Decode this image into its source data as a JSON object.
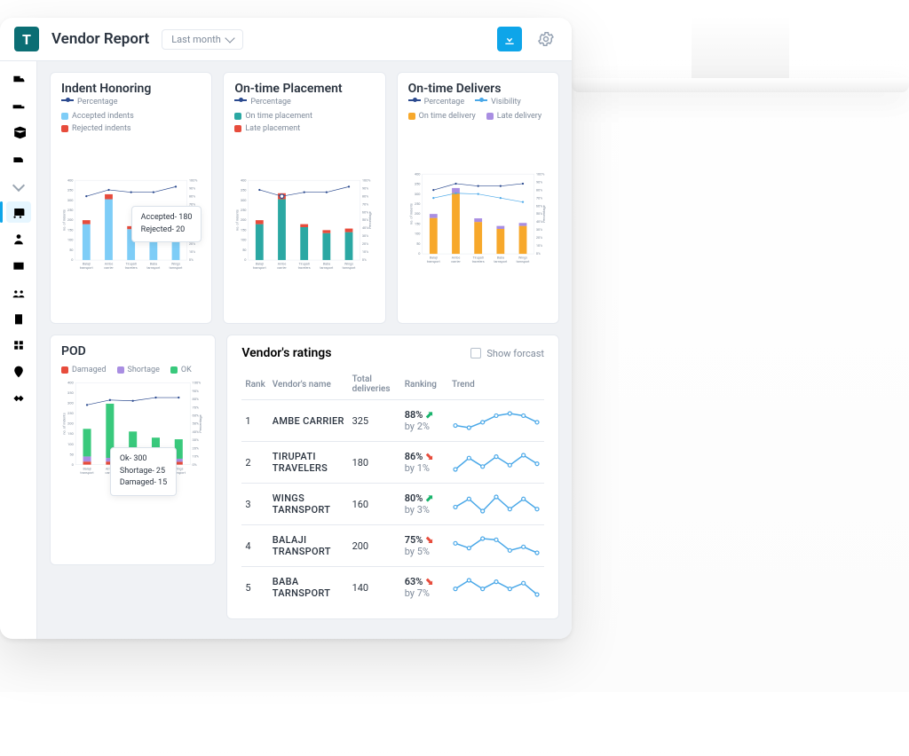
{
  "header": {
    "logo_letter": "T",
    "title": "Vendor Report",
    "period_label": "Last month"
  },
  "sidebar": {
    "items": [
      "truck",
      "trailer",
      "box",
      "van",
      "chevron",
      "bus",
      "user",
      "card",
      "team",
      "building",
      "apps",
      "map-pin",
      "handshake"
    ],
    "active_index": 5
  },
  "categories": [
    "Balaji transport",
    "Ambe carrier",
    "Tirupati travelers",
    "Baba tarnsport",
    "Wings tarnsport"
  ],
  "chart_data": [
    {
      "id": "indent",
      "title": "Indent Honoring",
      "type": "bar+line",
      "xlabel": "",
      "ylabel": "no. of indents",
      "y2label": "Percentage",
      "ylim": [
        0,
        400
      ],
      "y2lim": [
        0,
        100
      ],
      "yticks": [
        0,
        50,
        100,
        150,
        200,
        250,
        300,
        350,
        400
      ],
      "y2ticks": [
        0,
        10,
        20,
        30,
        40,
        50,
        60,
        70,
        80,
        90,
        100
      ],
      "legend_lines": [
        {
          "name": "Percentage",
          "color": "#2b4a8f"
        }
      ],
      "series": [
        {
          "name": "Accepted indents",
          "color": "#7ecdf7",
          "values": [
            180,
            305,
            155,
            130,
            140
          ]
        },
        {
          "name": "Rejected indents",
          "color": "#e74c3c",
          "values": [
            20,
            25,
            15,
            15,
            18
          ]
        }
      ],
      "line": {
        "name": "Percentage",
        "color": "#2b4a8f",
        "values": [
          80,
          88,
          85,
          85,
          92
        ]
      },
      "tooltip": {
        "index": 2,
        "lines": [
          "Accepted- 180",
          "Rejected- 20"
        ]
      }
    },
    {
      "id": "placement",
      "title": "On-time Placement",
      "type": "bar+line",
      "ylabel": "no. of indents",
      "y2label": "Percentage",
      "ylim": [
        0,
        400
      ],
      "y2lim": [
        0,
        100
      ],
      "yticks": [
        0,
        50,
        100,
        150,
        200,
        250,
        300,
        350,
        400
      ],
      "y2ticks": [
        0,
        10,
        20,
        30,
        40,
        50,
        60,
        70,
        80,
        90,
        100
      ],
      "legend_lines": [
        {
          "name": "Percentage",
          "color": "#2b4a8f"
        }
      ],
      "series": [
        {
          "name": "On time placement",
          "color": "#2ba8a3",
          "values": [
            180,
            305,
            165,
            135,
            140
          ]
        },
        {
          "name": "Late placement",
          "color": "#e74c3c",
          "values": [
            20,
            30,
            15,
            15,
            18
          ]
        }
      ],
      "line": {
        "name": "Percentage",
        "color": "#2b4a8f",
        "values": [
          88,
          80,
          85,
          85,
          92
        ]
      },
      "highlight_dot": 1
    },
    {
      "id": "delivers",
      "title": "On-time Delivers",
      "type": "bar+2line",
      "ylabel": "no. of indents",
      "y2label": "Percentage",
      "ylim": [
        0,
        400
      ],
      "y2lim": [
        0,
        100
      ],
      "yticks": [
        0,
        50,
        100,
        150,
        200,
        250,
        300,
        350,
        400
      ],
      "y2ticks": [
        0,
        10,
        20,
        30,
        40,
        50,
        60,
        70,
        80,
        90,
        100
      ],
      "legend_lines": [
        {
          "name": "Percentage",
          "color": "#2b4a8f"
        },
        {
          "name": "Visibility",
          "color": "#4aa8e8"
        }
      ],
      "series": [
        {
          "name": "On time delivery",
          "color": "#f7a82b",
          "values": [
            180,
            305,
            160,
            125,
            140
          ]
        },
        {
          "name": "Late delivery",
          "color": "#a98ee2",
          "values": [
            20,
            25,
            18,
            15,
            15
          ]
        }
      ],
      "line": {
        "name": "Percentage",
        "color": "#2b4a8f",
        "values": [
          80,
          88,
          85,
          85,
          88
        ]
      },
      "line2": {
        "name": "Visibility",
        "color": "#4aa8e8",
        "values": [
          70,
          76,
          75,
          70,
          65
        ]
      }
    },
    {
      "id": "pod",
      "title": "POD",
      "type": "bar+line",
      "ylabel": "no. of indents",
      "y2label": "Percentage",
      "ylim": [
        0,
        400
      ],
      "y2lim": [
        0,
        100
      ],
      "yticks": [
        0,
        50,
        100,
        150,
        200,
        250,
        300,
        350,
        400
      ],
      "y2ticks": [
        0,
        10,
        20,
        30,
        40,
        50,
        60,
        70,
        80,
        90,
        100
      ],
      "legend_lines": [],
      "series": [
        {
          "name": "Damaged",
          "color": "#e74c3c",
          "values": [
            15,
            15,
            12,
            12,
            14
          ]
        },
        {
          "name": "Shortage",
          "color": "#a98ee2",
          "values": [
            25,
            18,
            20,
            15,
            15
          ]
        },
        {
          "name": "OK",
          "color": "#39c97c",
          "values": [
            135,
            265,
            130,
            105,
            95
          ]
        }
      ],
      "line": {
        "name": "Percentage",
        "color": "#2b4a8f",
        "values": [
          73,
          79,
          78,
          82,
          82
        ]
      },
      "tooltip": {
        "index": 1,
        "lines": [
          "Ok- 300",
          "Shortage- 25",
          "Damaged- 15"
        ]
      }
    }
  ],
  "ratings": {
    "title": "Vendor's ratings",
    "show_forecast_label": "Show forcast",
    "columns": [
      "Rank",
      "Vendor's name",
      "Total deliveries",
      "Ranking",
      "Trend"
    ],
    "rows": [
      {
        "rank": 1,
        "name": "AMBE CARRIER",
        "total": 325,
        "pct": "88%",
        "dir": "up",
        "delta": "2%",
        "spark": [
          5,
          3,
          8,
          14,
          16,
          14,
          8
        ]
      },
      {
        "rank": 2,
        "name": "TIRUPATI TRAVELERS",
        "total": 180,
        "pct": "86%",
        "dir": "down",
        "delta": "1%",
        "spark": [
          4,
          12,
          6,
          13,
          7,
          14,
          8
        ]
      },
      {
        "rank": 3,
        "name": "WINGS TARNSPORT",
        "total": 160,
        "pct": "80%",
        "dir": "up",
        "delta": "3%",
        "spark": [
          10,
          14,
          8,
          15,
          9,
          14,
          9
        ]
      },
      {
        "rank": 4,
        "name": "BALAJI TRANSPORT",
        "total": 200,
        "pct": "75%",
        "dir": "down",
        "delta": "5%",
        "spark": [
          12,
          8,
          16,
          15,
          6,
          9,
          4
        ]
      },
      {
        "rank": 5,
        "name": "BABA TARNSPORT",
        "total": 140,
        "pct": "63%",
        "dir": "down",
        "delta": "7%",
        "spark": [
          8,
          14,
          8,
          13,
          8,
          12,
          4
        ]
      }
    ]
  }
}
